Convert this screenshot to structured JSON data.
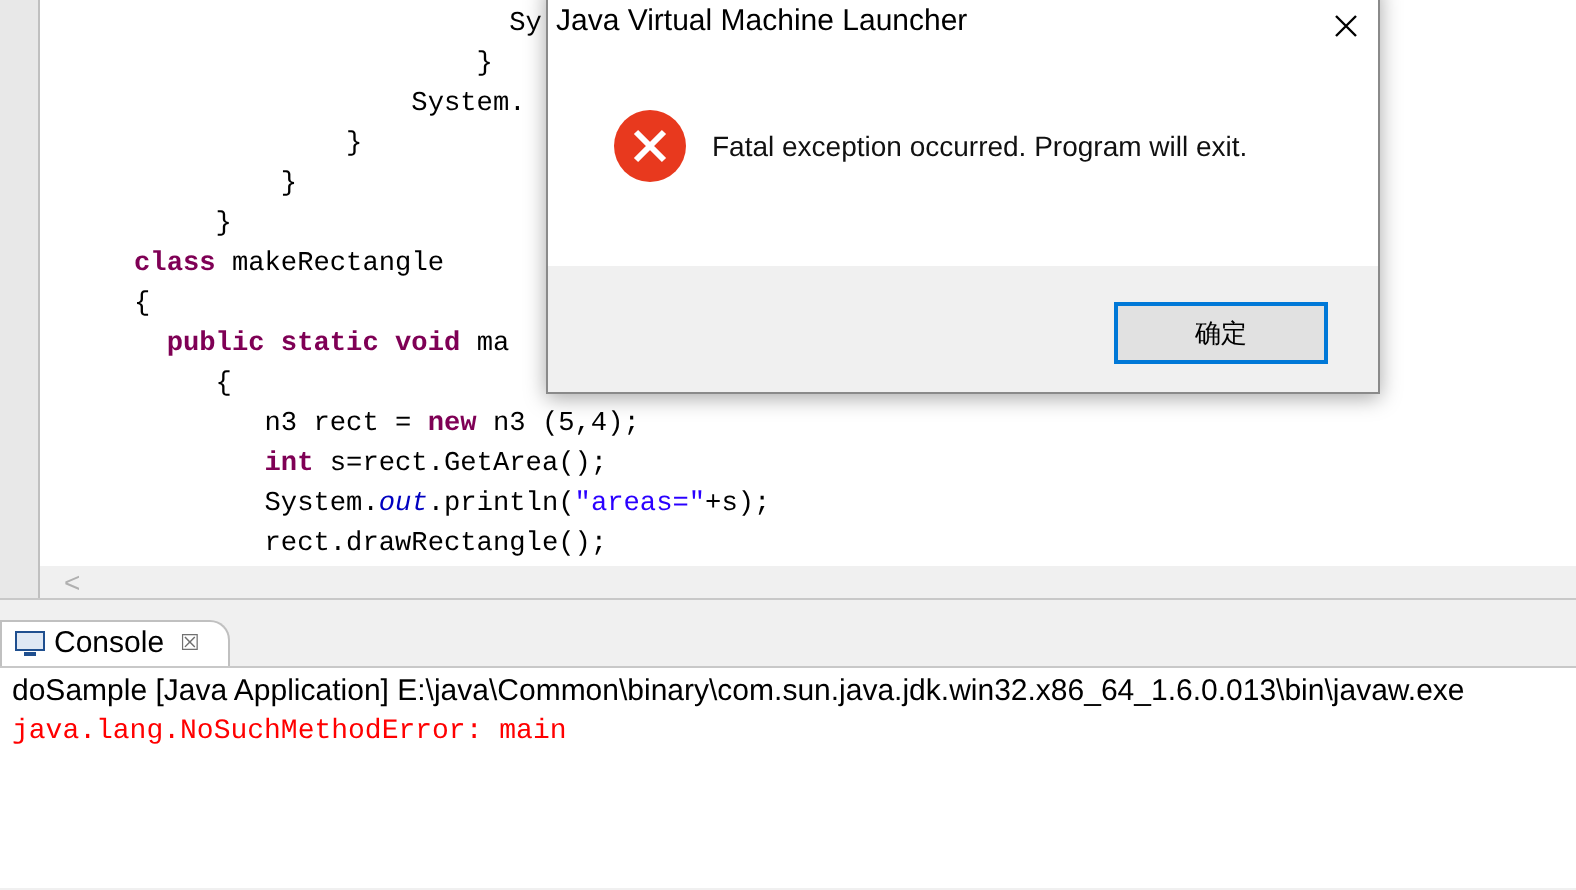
{
  "editor": {
    "lines": [
      [
        {
          "kind": "plain",
          "text": "                       Sy"
        }
      ],
      [
        {
          "kind": "plain",
          "text": "                     }"
        }
      ],
      [
        {
          "kind": "plain",
          "text": "                 System."
        }
      ],
      [
        {
          "kind": "plain",
          "text": "             }"
        }
      ],
      [
        {
          "kind": "plain",
          "text": "         }"
        }
      ],
      [
        {
          "kind": "plain",
          "text": "     }"
        }
      ],
      [
        {
          "kind": "keyword",
          "text": "class"
        },
        {
          "kind": "plain",
          "text": " makeRectangle"
        }
      ],
      [
        {
          "kind": "plain",
          "text": "{"
        }
      ],
      [
        {
          "kind": "keyword",
          "text": "  public static void"
        },
        {
          "kind": "plain",
          "text": " ma"
        }
      ],
      [
        {
          "kind": "plain",
          "text": "     {"
        }
      ],
      [
        {
          "kind": "plain",
          "text": "        n3 rect = "
        },
        {
          "kind": "keyword",
          "text": "new"
        },
        {
          "kind": "plain",
          "text": " n3 (5,4);"
        }
      ],
      [
        {
          "kind": "keyword",
          "text": "        int"
        },
        {
          "kind": "plain",
          "text": " s=rect.GetArea();"
        }
      ],
      [
        {
          "kind": "plain",
          "text": "        System."
        },
        {
          "kind": "field",
          "text": "out"
        },
        {
          "kind": "plain",
          "text": ".println("
        },
        {
          "kind": "string",
          "text": "\"areas=\""
        },
        {
          "kind": "plain",
          "text": "+s);"
        }
      ],
      [
        {
          "kind": "plain",
          "text": "        rect.drawRectangle();"
        }
      ]
    ],
    "scroll_left": "<"
  },
  "console": {
    "tab": {
      "label": "Console",
      "close": "☒"
    },
    "header": "doSample [Java Application] E:\\java\\Common\\binary\\com.sun.java.jdk.win32.x86_64_1.6.0.013\\bin\\javaw.exe",
    "output": [
      {
        "kind": "error",
        "text": "java.lang.NoSuchMethodError: main"
      }
    ]
  },
  "dialog": {
    "title": "Java Virtual Machine Launcher",
    "message": "Fatal exception occurred.  Program will exit.",
    "buttons": [
      {
        "label": "确定",
        "selected": true
      }
    ]
  }
}
